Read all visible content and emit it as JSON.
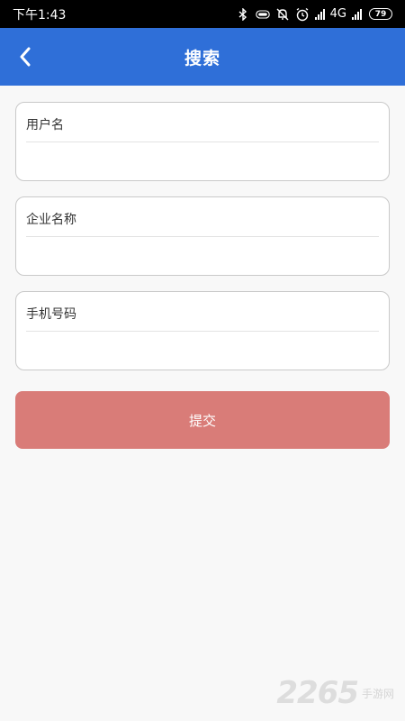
{
  "status_bar": {
    "time": "下午1:43",
    "network": "4G",
    "battery": "79"
  },
  "header": {
    "title": "搜索"
  },
  "form": {
    "fields": [
      {
        "label": "用户名",
        "value": ""
      },
      {
        "label": "企业名称",
        "value": ""
      },
      {
        "label": "手机号码",
        "value": ""
      }
    ],
    "submit_label": "提交"
  },
  "watermark": {
    "digits": "2265",
    "text": "手游网"
  },
  "colors": {
    "appbar": "#2f6fd8",
    "submit": "#d97c78",
    "background": "#f8f8f8"
  }
}
